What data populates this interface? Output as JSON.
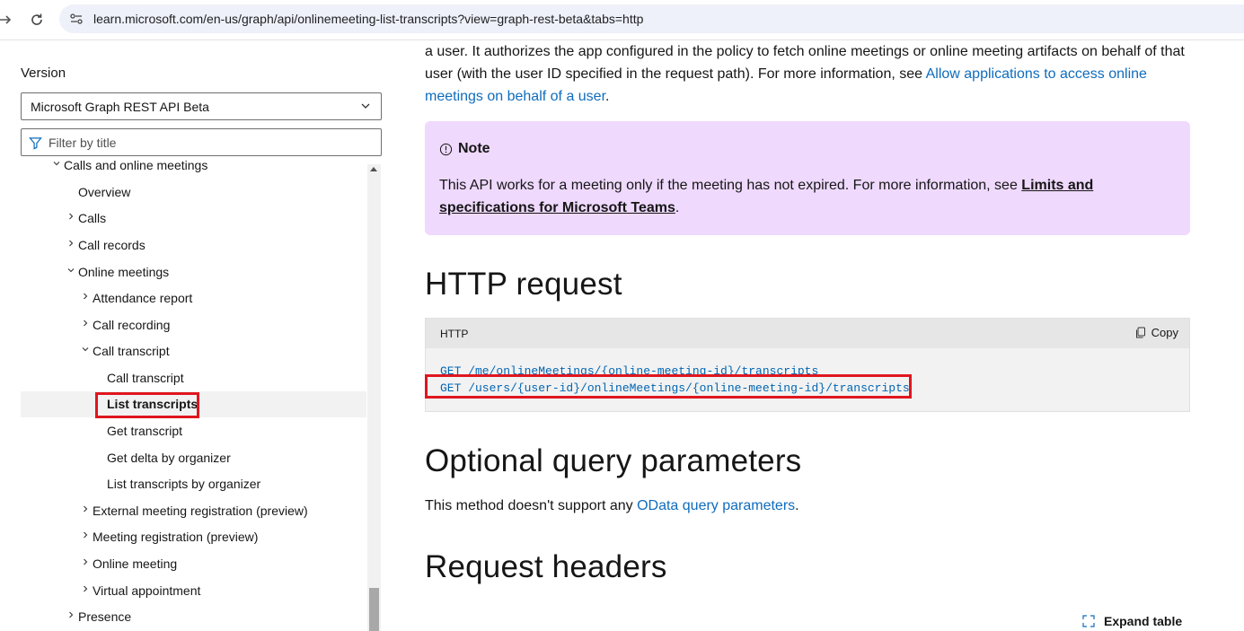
{
  "browser": {
    "url": "learn.microsoft.com/en-us/graph/api/onlinemeeting-list-transcripts?view=graph-rest-beta&tabs=http"
  },
  "sidebar": {
    "version_label": "Version",
    "version_selected": "Microsoft Graph REST API Beta",
    "filter_placeholder": "Filter by title",
    "toc": [
      {
        "label": "Calls and online meetings",
        "level": 1,
        "expanded": true
      },
      {
        "label": "Overview",
        "level": 2
      },
      {
        "label": "Calls",
        "level": 2,
        "expanded": false
      },
      {
        "label": "Call records",
        "level": 2,
        "expanded": false
      },
      {
        "label": "Online meetings",
        "level": 2,
        "expanded": true
      },
      {
        "label": "Attendance report",
        "level": 3,
        "expanded": false
      },
      {
        "label": "Call recording",
        "level": 3,
        "expanded": false
      },
      {
        "label": "Call transcript",
        "level": 3,
        "expanded": true
      },
      {
        "label": "Call transcript",
        "level": 4
      },
      {
        "label": "List transcripts",
        "level": 4,
        "active": true
      },
      {
        "label": "Get transcript",
        "level": 4
      },
      {
        "label": "Get delta by organizer",
        "level": 4
      },
      {
        "label": "List transcripts by organizer",
        "level": 4
      },
      {
        "label": "External meeting registration (preview)",
        "level": 3,
        "expanded": false
      },
      {
        "label": "Meeting registration (preview)",
        "level": 3,
        "expanded": false
      },
      {
        "label": "Online meeting",
        "level": 3,
        "expanded": false
      },
      {
        "label": "Virtual appointment",
        "level": 3,
        "expanded": false
      },
      {
        "label": "Presence",
        "level": 2,
        "expanded": false
      }
    ]
  },
  "main": {
    "intro_text_1": "a user. It authorizes the app configured in the policy to fetch online meetings or online meeting artifacts on behalf of that user (with the user ID specified in the request path). For more information, see ",
    "intro_link": "Allow applications to access online meetings on behalf of a user",
    "intro_text_2": ".",
    "note": {
      "title": "Note",
      "text_1": "This API works for a meeting only if the meeting has not expired. For more information, see ",
      "link": "Limits and specifications for Microsoft Teams",
      "text_2": "."
    },
    "http_request_heading": "HTTP request",
    "code": {
      "language": "HTTP",
      "copy_label": "Copy",
      "line_1": "GET /me/onlineMeetings/{online-meeting-id}/transcripts",
      "line_2": "GET /users/{user-id}/onlineMeetings/{online-meeting-id}/transcripts"
    },
    "optional_heading": "Optional query parameters",
    "optional_text_1": "This method doesn't support any ",
    "optional_link": "OData query parameters",
    "optional_text_2": ".",
    "request_headers_heading": "Request headers",
    "expand_table_label": "Expand table"
  },
  "colors": {
    "link": "#0f6cbd",
    "note_bg": "#efd9fd",
    "highlight": "#e0161f",
    "code_text": "#0065b3"
  }
}
